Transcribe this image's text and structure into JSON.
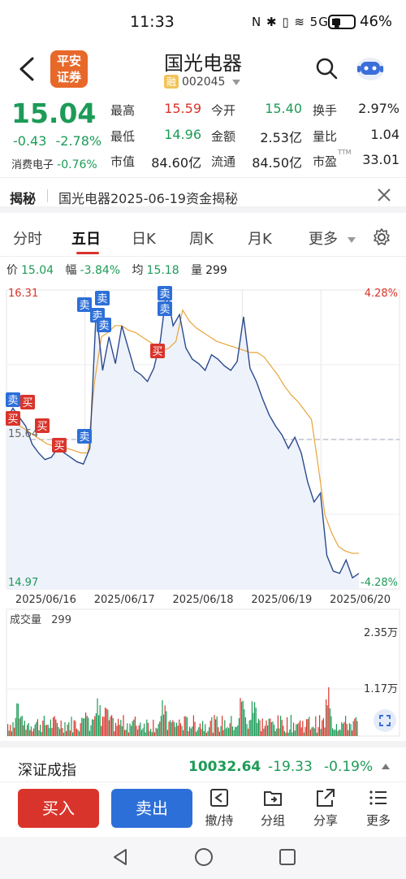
{
  "status_bar": {
    "time": "11:33",
    "icons": "N ✱ ▯ ≋ 5G ▮",
    "battery": "46%"
  },
  "header": {
    "broker_logo_line1": "平安",
    "broker_logo_line2": "证券",
    "stock_name": "国光电器",
    "rong_badge": "融",
    "stock_code": "002045"
  },
  "quote": {
    "price": "15.04",
    "change": "-0.43",
    "change_pct": "-2.78%",
    "sector_name": "消费电子",
    "sector_pct": "-0.76%",
    "fields": [
      {
        "label": "最高",
        "value": "15.59",
        "color": "red"
      },
      {
        "label": "今开",
        "value": "15.40",
        "color": "green"
      },
      {
        "label": "换手",
        "value": "2.97%",
        "color": "dark"
      },
      {
        "label": "最低",
        "value": "14.96",
        "color": "green"
      },
      {
        "label": "金额",
        "value": "2.53亿",
        "color": "dark"
      },
      {
        "label": "量比",
        "value": "1.04",
        "color": "dark"
      },
      {
        "label": "市值",
        "value": "84.60亿",
        "color": "dark"
      },
      {
        "label": "流通",
        "value": "84.50亿",
        "color": "dark"
      },
      {
        "label": "市盈",
        "value": "33.01",
        "color": "dark",
        "sup": "TTM"
      }
    ]
  },
  "reveal": {
    "title": "揭秘",
    "text": "国光电器2025-06-19资金揭秘"
  },
  "tabs": [
    {
      "label": "分时"
    },
    {
      "label": "五日"
    },
    {
      "label": "日K"
    },
    {
      "label": "周K"
    },
    {
      "label": "月K"
    },
    {
      "label": "更多"
    }
  ],
  "info": {
    "price_label": "价",
    "price": "15.04",
    "range_label": "幅",
    "range": "-3.84%",
    "avg_label": "均",
    "avg": "15.18",
    "vol_label": "量",
    "vol": "299"
  },
  "chart_data": {
    "type": "line",
    "title": "",
    "y_top": "16.31",
    "y_mid": "15.64",
    "y_bottom": "14.97",
    "pct_top": "4.28%",
    "pct_bottom": "-4.28%",
    "ylim": [
      14.97,
      16.31
    ],
    "x_labels": [
      "2025/06/16",
      "2025/06/17",
      "2025/06/18",
      "2025/06/19",
      "2025/06/20"
    ],
    "series": [
      {
        "values": [
          15.73,
          15.78,
          15.74,
          15.7,
          15.62,
          15.58,
          15.55,
          15.56,
          15.6,
          15.58,
          15.56,
          15.54,
          15.53,
          15.6,
          16.22,
          15.95,
          16.1,
          15.98,
          16.15,
          16.05,
          15.95,
          15.93,
          15.9,
          15.96,
          16.08,
          16.31,
          16.15,
          16.2,
          16.05,
          16.0,
          15.98,
          15.95,
          16.02,
          16.0,
          15.97,
          15.95,
          15.99,
          16.19,
          15.96,
          15.9,
          15.82,
          15.75,
          15.7,
          15.66,
          15.6,
          15.65,
          15.58,
          15.45,
          15.36,
          15.4,
          15.12,
          15.05,
          15.04,
          15.1,
          15.02,
          15.04
        ]
      },
      {
        "values": [
          15.73,
          15.72,
          15.7,
          15.68,
          15.66,
          15.64,
          15.62,
          15.61,
          15.6,
          15.6,
          15.59,
          15.58,
          15.58,
          15.9,
          16.1,
          16.12,
          16.15,
          16.15,
          16.13,
          16.12,
          16.1,
          16.08,
          16.06,
          16.04,
          16.05,
          16.08,
          16.22,
          16.17,
          16.14,
          16.12,
          16.1,
          16.08,
          16.07,
          16.06,
          16.05,
          16.04,
          16.03,
          16.03,
          16.01,
          15.97,
          15.93,
          15.88,
          15.84,
          15.81,
          15.77,
          15.73,
          15.52,
          15.3,
          15.22,
          15.16,
          15.14,
          15.13,
          15.13
        ]
      }
    ],
    "trade_markers": [
      {
        "label": "卖",
        "kind": "sell",
        "day": 0
      },
      {
        "label": "买",
        "kind": "buy",
        "day": 0
      },
      {
        "label": "买",
        "kind": "buy",
        "day": 0
      },
      {
        "label": "买",
        "kind": "buy",
        "day": 0
      },
      {
        "label": "买",
        "kind": "buy",
        "day": 0
      },
      {
        "label": "卖",
        "kind": "sell",
        "day": 0
      },
      {
        "label": "卖",
        "kind": "sell",
        "day": 1
      },
      {
        "label": "卖",
        "kind": "sell",
        "day": 1
      },
      {
        "label": "卖",
        "kind": "sell",
        "day": 1
      },
      {
        "label": "卖",
        "kind": "sell",
        "day": 1
      },
      {
        "label": "买",
        "kind": "buy",
        "day": 1
      },
      {
        "label": "卖",
        "kind": "sell",
        "day": 1
      },
      {
        "label": "卖",
        "kind": "sell",
        "day": 1
      }
    ]
  },
  "volume": {
    "title": "成交量",
    "value": "299",
    "y_top": "2.35万",
    "y_mid": "1.17万"
  },
  "index": {
    "name": "深证成指",
    "value": "10032.64",
    "change": "-19.33",
    "pct": "-0.19%"
  },
  "toolbar": {
    "buy": "买入",
    "sell": "卖出",
    "tools": [
      {
        "label": "撤/持"
      },
      {
        "label": "分组"
      },
      {
        "label": "分享"
      },
      {
        "label": "更多"
      }
    ]
  },
  "colors": {
    "up": "#d9342b",
    "down": "#1d9b57",
    "line": "#2a4a8c",
    "avg": "#e8a43a",
    "sell_marker": "#2d6fd8",
    "buy_marker": "#d9342b"
  }
}
